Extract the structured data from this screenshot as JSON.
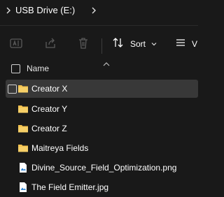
{
  "breadcrumb": {
    "location": "USB Drive (E:)"
  },
  "toolbar": {
    "sort_label": "Sort",
    "view_label": "V"
  },
  "columns": {
    "name": "Name"
  },
  "files": [
    {
      "name": "Creator X",
      "type": "folder",
      "selected": true
    },
    {
      "name": "Creator Y",
      "type": "folder",
      "selected": false
    },
    {
      "name": "Creator Z",
      "type": "folder",
      "selected": false
    },
    {
      "name": "Maitreya Fields",
      "type": "folder",
      "selected": false
    },
    {
      "name": "Divine_Source_Field_Optimization.png",
      "type": "image",
      "selected": false
    },
    {
      "name": "The Field Emitter.jpg",
      "type": "image",
      "selected": false
    }
  ],
  "colors": {
    "background": "#191919",
    "selected_row": "#383838",
    "folder": "#f2c14e",
    "image_icon": "#2f86d6"
  }
}
